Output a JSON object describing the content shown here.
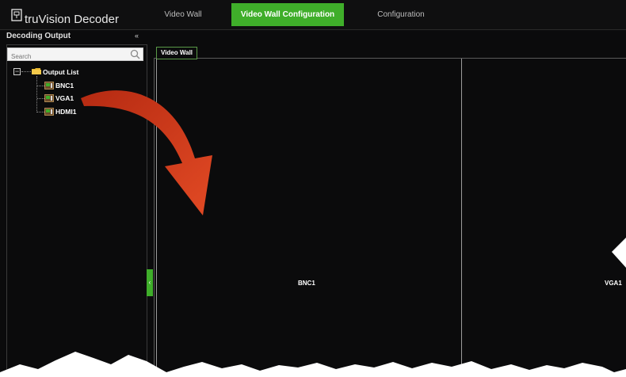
{
  "app": {
    "brand": "truVision Decoder"
  },
  "tabs": [
    {
      "label": "Video Wall",
      "active": false
    },
    {
      "label": "Video Wall Configuration",
      "active": true
    },
    {
      "label": "Configuration",
      "active": false
    }
  ],
  "left_panel": {
    "title": "Decoding Output",
    "collapse_glyph": "«",
    "search_placeholder": "Search",
    "tree": {
      "root_label": "Output List",
      "root_toggle": "−",
      "items": [
        {
          "label": "BNC1",
          "icon": "video-output-icon"
        },
        {
          "label": "VGA1",
          "icon": "video-output-icon"
        },
        {
          "label": "HDMI1",
          "icon": "video-output-icon"
        }
      ]
    }
  },
  "splitter_glyph": "‹",
  "video_wall": {
    "tab_label": "Video Wall",
    "screens": [
      {
        "label": "BNC1"
      },
      {
        "label": "VGA1"
      }
    ]
  },
  "annotation": {
    "icon": "curved-arrow-icon",
    "color": "#d63d1e"
  },
  "colors": {
    "accent": "#3fae2a",
    "background": "#0b0b0c",
    "arrow": "#d63d1e"
  }
}
